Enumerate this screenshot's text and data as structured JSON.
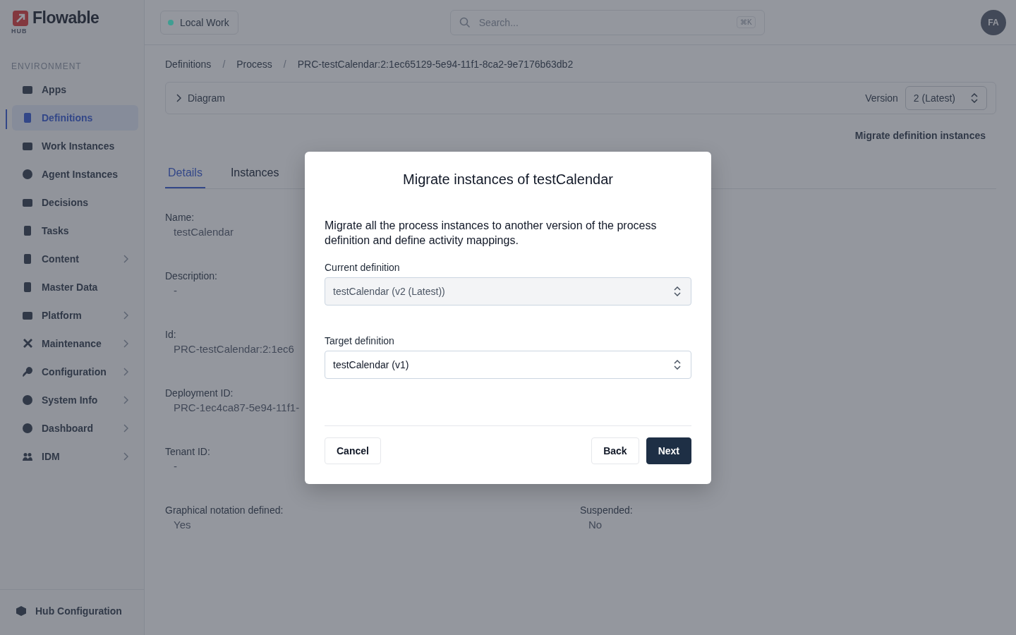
{
  "logo": {
    "name": "Flowable",
    "sub": "HUB"
  },
  "workspace": {
    "label": "Local Work",
    "color": "#3f9e92"
  },
  "search": {
    "placeholder": "Search...",
    "shortcut": "⌘K"
  },
  "avatar": "FA",
  "sidebar": {
    "heading": "ENVIRONMENT",
    "items": [
      {
        "label": "Apps",
        "selected": false,
        "expandable": false
      },
      {
        "label": "Definitions",
        "selected": true,
        "expandable": false
      },
      {
        "label": "Work Instances",
        "selected": false,
        "expandable": false
      },
      {
        "label": "Agent Instances",
        "selected": false,
        "expandable": false
      },
      {
        "label": "Decisions",
        "selected": false,
        "expandable": false
      },
      {
        "label": "Tasks",
        "selected": false,
        "expandable": false
      },
      {
        "label": "Content",
        "selected": false,
        "expandable": true
      },
      {
        "label": "Master Data",
        "selected": false,
        "expandable": false
      },
      {
        "label": "Platform",
        "selected": false,
        "expandable": true
      },
      {
        "label": "Maintenance",
        "selected": false,
        "expandable": true
      },
      {
        "label": "Configuration",
        "selected": false,
        "expandable": true
      },
      {
        "label": "System Info",
        "selected": false,
        "expandable": true
      },
      {
        "label": "Dashboard",
        "selected": false,
        "expandable": true
      },
      {
        "label": "IDM",
        "selected": false,
        "expandable": true
      }
    ],
    "footer": "Hub Configuration"
  },
  "breadcrumb_separator": "/",
  "breadcrumbs": [
    "Definitions",
    "Process",
    "PRC-testCalendar:2:1ec65129-5e94-11f1-8ca2-9e7176b63db2"
  ],
  "diagram": {
    "label": "Diagram",
    "expanded": false,
    "version_label": "Version",
    "version": "2 (Latest)"
  },
  "migrate_link": "Migrate definition instances",
  "tabs": [
    {
      "label": "Details",
      "selected": true
    },
    {
      "label": "Instances",
      "selected": false
    }
  ],
  "fields": [
    {
      "label": "Name:",
      "value": "testCalendar"
    },
    {
      "label": "Description:",
      "value": "-"
    },
    {
      "label": "Id:",
      "value": "PRC-testCalendar:2:1ec6"
    },
    {
      "label": "Deployment ID:",
      "value": "PRC-1ec4ca87-5e94-11f1-"
    },
    {
      "label": "Tenant ID:",
      "value": "-"
    },
    {
      "label": "Graphical notation defined:",
      "value": "Yes"
    }
  ],
  "fields_right": [
    {
      "label": "Suspended:",
      "value": "No"
    }
  ],
  "dialog": {
    "title": "Migrate instances of testCalendar",
    "text": "Migrate all the process instances to another version of the process definition and define activity mappings.",
    "selects": [
      {
        "label": "Current definition",
        "value": "testCalendar (v2 (Latest))",
        "disabled": true
      },
      {
        "label": "Target definition",
        "value": "testCalendar (v1)",
        "disabled": false
      }
    ],
    "cancel": "Cancel",
    "back": "Back",
    "next": "Next"
  }
}
